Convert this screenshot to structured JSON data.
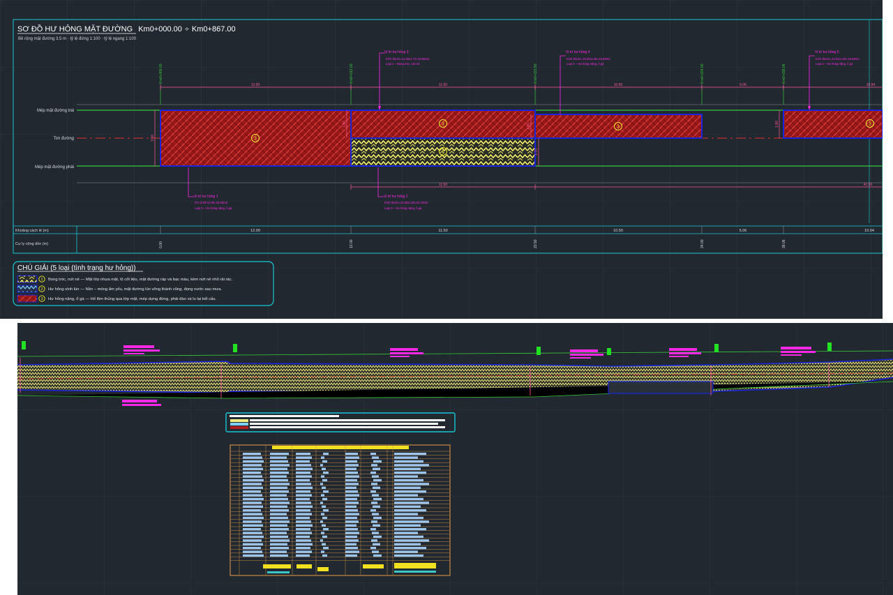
{
  "drawing": {
    "title": "SƠ ĐỒ HƯ HỎNG MẶT ĐƯỜNG",
    "range_start": "Km0+000.00",
    "range_sep": "÷",
    "range_end": "Km0+867.00",
    "subtitle": "Bề rộng mặt đường 3.5 m  ·  tỷ lệ đứng 1:100  ·  tỷ lệ ngang 1:100"
  },
  "row_labels": {
    "left_edge": "Mép mặt đường trái",
    "centerline": "Tim đường",
    "right_edge": "Mép mặt đường phải"
  },
  "stations": [
    "Km0+000.00",
    "Km0+012.00",
    "Km0+023.50",
    "Km0+034.00",
    "Km0+039.06"
  ],
  "top_dims": [
    "12.00",
    "11.50",
    "10.50",
    "5.06",
    "10.94"
  ],
  "bottom_dims": [
    "11.50",
    "41.50"
  ],
  "bands": [
    {
      "symbol": "3",
      "height_label": "3.50"
    },
    {
      "symbol": "3",
      "height_label": "1.80"
    },
    {
      "symbol": "1",
      "height_label": "1.70"
    },
    {
      "symbol": "3",
      "height_label": "1.80"
    },
    {
      "symbol": "3",
      "height_label": "1.80"
    }
  ],
  "damage_labels": [
    {
      "title": "Vị trí hư hỏng 1",
      "line1": "DT=3.50*12.00=42.00m2",
      "line2": "Loại 3 – Hư hỏng nặng, ổ gà"
    },
    {
      "title": "Vị trí hư hỏng 2",
      "line1": "Kích thước=11.50x1.80=20.70m2",
      "line2": "Loại 3 – Hư hỏng nặng, ổ gà"
    },
    {
      "title": "Vị trí hư hỏng 3",
      "line1": "Kích thước=11.50x1.70=19.55m2",
      "line2": "Loại 1 – Bong tróc, nứt nẻ"
    },
    {
      "title": "Vị trí hư hỏng 4",
      "line1": "Kích thước=10.50x1.80=18.90m2",
      "line2": "Loại 3 – Hư hỏng nặng, ổ gà"
    },
    {
      "title": "Vị trí hư hỏng 5",
      "line1": "Kích thước=10.94x1.80=19.69m2",
      "line2": "Loại 3 – Hư hỏng nặng, ổ gà"
    }
  ],
  "table": {
    "row1_label": "Khoảng cách lẻ (m)",
    "row2_label": "Cự ly cộng dồn (m)",
    "distances": [
      "12.00",
      "11.50",
      "10.50",
      "5.06",
      "10.94"
    ],
    "cumulative": [
      "0.00",
      "12.00",
      "23.50",
      "34.00",
      "39.06"
    ]
  },
  "legend": {
    "title": "CHÚ GIẢI  (5 loại (tình trạng hư hỏng))",
    "items": [
      {
        "num": "1",
        "text": "Bong tróc, nứt nẻ — Mặt lớp nhựa mặt, lộ cốt liệu, mặt đường ráp và bạc màu, kèm nứt nẻ nhỏ rải rác."
      },
      {
        "num": "2",
        "text": "Hư hỏng sình lún — Nền – móng ẩm yếu, mặt đường lún võng thành vũng, đọng nước sau mưa."
      },
      {
        "num": "3",
        "text": "Hư hỏng nặng, ổ gà — Hố lõm thủng qua lớp mặt, mép dựng đứng, phải đào và lu lại kết cấu."
      }
    ]
  },
  "colors": {
    "background": "#212830",
    "frame": "#19c8d2",
    "damage_red": "#b01e1e",
    "hatch_outline": "#1a24d8",
    "crack_yellow": "#f0ec6c",
    "dimension_pink": "#ff5aa0",
    "label_magenta": "#ff28e6",
    "station_green": "#3ac83a",
    "table_orange": "#c88c46"
  }
}
